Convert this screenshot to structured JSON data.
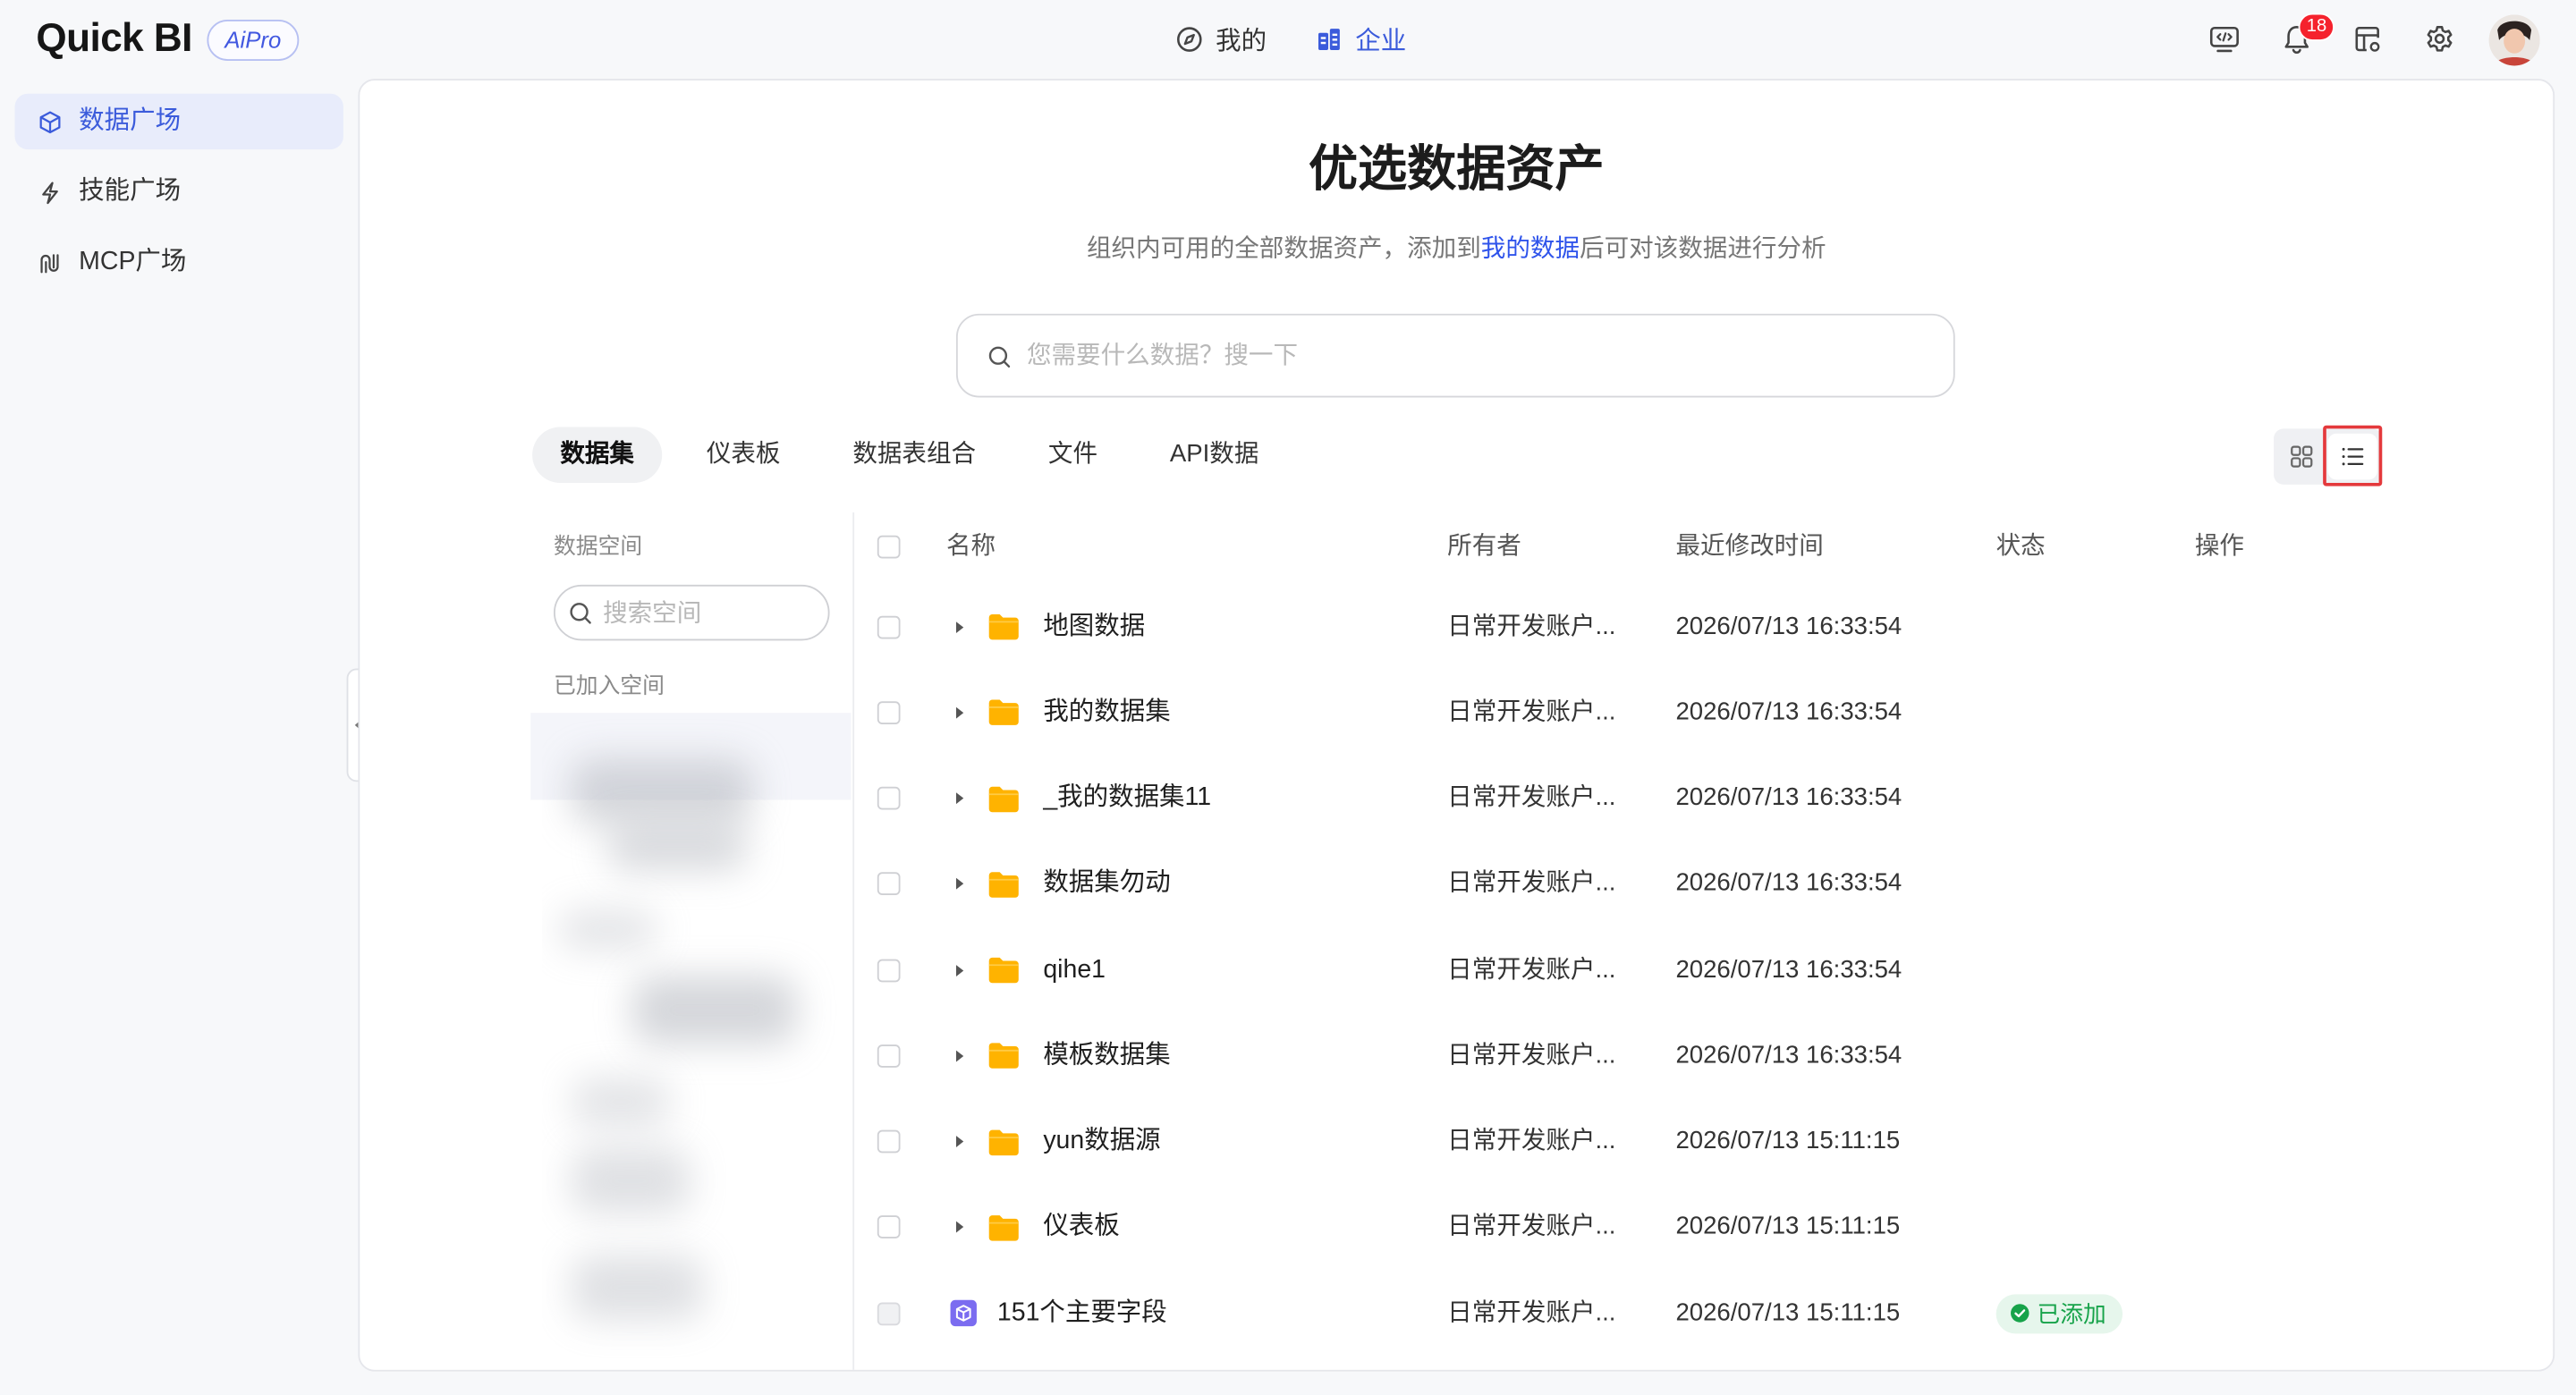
{
  "app": {
    "logo_text": "Quick BI",
    "badge_text": "AiPro"
  },
  "top_nav": [
    {
      "label": "我的",
      "icon": "compass-icon",
      "active": false
    },
    {
      "label": "企业",
      "icon": "building-icon",
      "active": true
    }
  ],
  "header_actions": [
    {
      "icon": "code-monitor-icon"
    },
    {
      "icon": "bell-icon",
      "badge": "18"
    },
    {
      "icon": "table-settings-icon"
    },
    {
      "icon": "gear-icon"
    },
    {
      "icon": "avatar"
    }
  ],
  "sidebar": {
    "items": [
      {
        "label": "数据广场",
        "icon": "cube-icon",
        "active": true
      },
      {
        "label": "技能广场",
        "icon": "lightning-icon",
        "active": false
      },
      {
        "label": "MCP广场",
        "icon": "mcp-icon",
        "active": false
      }
    ]
  },
  "hero": {
    "title": "优选数据资产",
    "subtitle_before": "组织内可用的全部数据资产，添加到",
    "subtitle_link": "我的数据",
    "subtitle_after": "后可对该数据进行分析"
  },
  "search": {
    "placeholder": "您需要什么数据？搜一下"
  },
  "tabs": [
    {
      "label": "数据集",
      "active": true
    },
    {
      "label": "仪表板",
      "active": false
    },
    {
      "label": "数据表组合",
      "active": false
    },
    {
      "label": "文件",
      "active": false
    },
    {
      "label": "API数据",
      "active": false
    }
  ],
  "view_toggle": {
    "options": [
      {
        "icon": "grid-icon",
        "active": false
      },
      {
        "icon": "list-icon",
        "active": true,
        "highlighted": true
      }
    ]
  },
  "space_panel": {
    "title": "数据空间",
    "search_placeholder": "搜索空间",
    "joined_label": "已加入空间"
  },
  "table": {
    "columns": [
      "名称",
      "所有者",
      "最近修改时间",
      "状态",
      "操作"
    ],
    "rows": [
      {
        "icon": "folder-icon",
        "name": "地图数据",
        "owner": "日常开发账户...",
        "modified": "2026/07/13 16:33:54"
      },
      {
        "icon": "folder-icon",
        "name": "我的数据集",
        "owner": "日常开发账户...",
        "modified": "2026/07/13 16:33:54"
      },
      {
        "icon": "folder-icon",
        "name": "_我的数据集11",
        "owner": "日常开发账户...",
        "modified": "2026/07/13 16:33:54"
      },
      {
        "icon": "folder-icon",
        "name": "数据集勿动",
        "owner": "日常开发账户...",
        "modified": "2026/07/13 16:33:54"
      },
      {
        "icon": "folder-icon",
        "name": "qihe1",
        "owner": "日常开发账户...",
        "modified": "2026/07/13 16:33:54"
      },
      {
        "icon": "folder-icon",
        "name": "模板数据集",
        "owner": "日常开发账户...",
        "modified": "2026/07/13 16:33:54"
      },
      {
        "icon": "folder-icon",
        "name": "yun数据源",
        "owner": "日常开发账户...",
        "modified": "2026/07/13 15:11:15"
      },
      {
        "icon": "folder-icon",
        "name": "仪表板",
        "owner": "日常开发账户...",
        "modified": "2026/07/13 15:11:15"
      },
      {
        "icon": "dataset-icon",
        "name": "151个主要字段",
        "owner": "日常开发账户...",
        "modified": "2026/07/13 15:11:15",
        "status": "已添加"
      }
    ]
  },
  "colors": {
    "accent": "#3b5bdb",
    "link": "#2f54eb",
    "folder": "#ffb300",
    "dataset": "#7b6cf0",
    "status_added_bg": "#e6f6ec",
    "status_added_text": "#17a34a",
    "notification": "#f5222d",
    "highlight": "#e4393c",
    "page_bg": "#f7f8fa"
  }
}
